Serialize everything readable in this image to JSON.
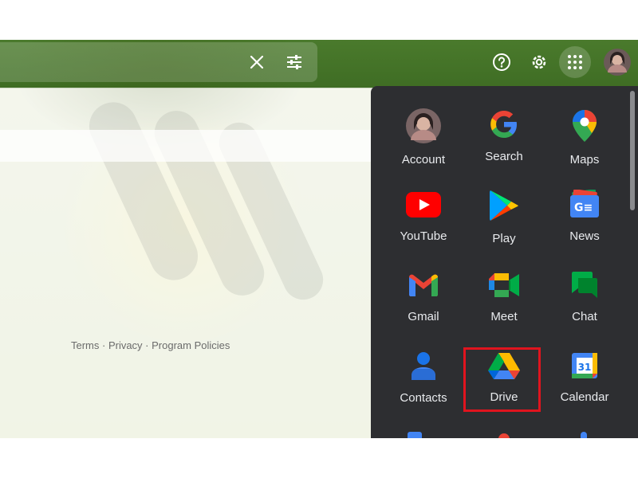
{
  "topbar": {
    "clear_icon": "close-icon",
    "filter_icon": "tune-icon",
    "help_icon": "help-icon",
    "settings_icon": "gear-icon",
    "apps_icon": "apps-grid-icon",
    "account_icon": "avatar"
  },
  "footer": {
    "links": "Terms · Privacy · Program Policies"
  },
  "apps_panel": {
    "items": [
      {
        "label": "Account",
        "icon": "account-avatar-icon"
      },
      {
        "label": "Search",
        "icon": "google-g-icon"
      },
      {
        "label": "Maps",
        "icon": "maps-pin-icon"
      },
      {
        "label": "YouTube",
        "icon": "youtube-icon"
      },
      {
        "label": "Play",
        "icon": "play-store-icon"
      },
      {
        "label": "News",
        "icon": "news-icon"
      },
      {
        "label": "Gmail",
        "icon": "gmail-icon"
      },
      {
        "label": "Meet",
        "icon": "meet-icon"
      },
      {
        "label": "Chat",
        "icon": "chat-icon"
      },
      {
        "label": "Contacts",
        "icon": "contacts-icon"
      },
      {
        "label": "Drive",
        "icon": "drive-icon"
      },
      {
        "label": "Calendar",
        "icon": "calendar-icon"
      }
    ],
    "calendar_day": "31",
    "news_badge": "G≡"
  },
  "colors": {
    "panel_bg": "#2d2e31",
    "label_text": "#e8eaed",
    "highlight": "#e0141e"
  }
}
